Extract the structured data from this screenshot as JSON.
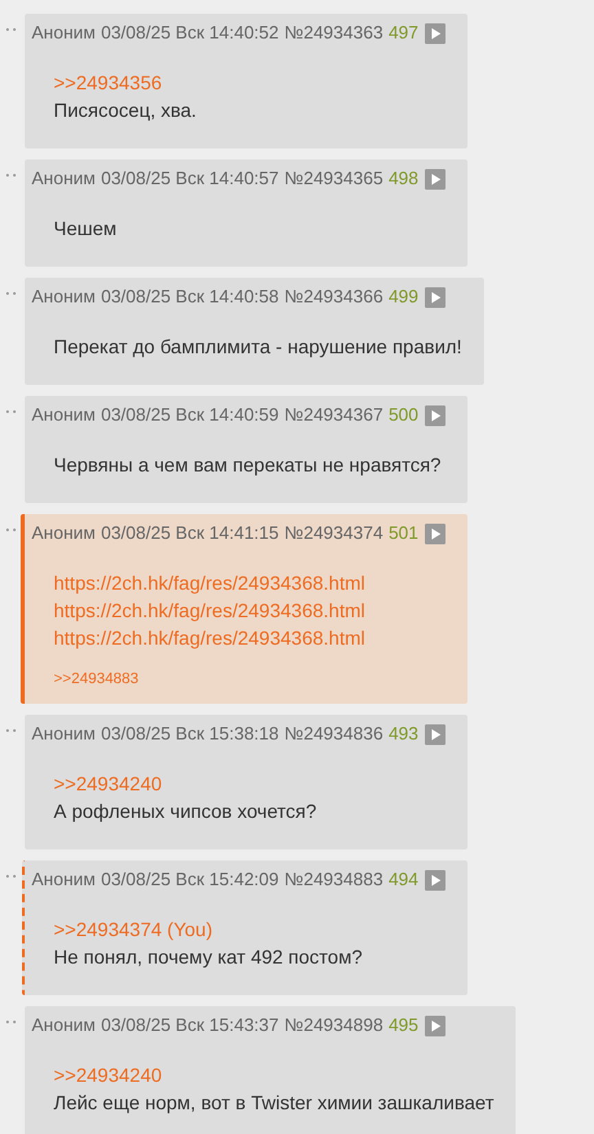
{
  "posts": [
    {
      "author": "Аноним",
      "datetime": "03/08/25 Вск 14:40:52",
      "number": "№24934363",
      "count": "497",
      "own": false,
      "replies_to_you": false,
      "lines": [
        {
          "kind": "reply",
          "text": ">>24934356"
        },
        {
          "kind": "text",
          "text": "Писясосец, хва."
        }
      ]
    },
    {
      "author": "Аноним",
      "datetime": "03/08/25 Вск 14:40:57",
      "number": "№24934365",
      "count": "498",
      "own": false,
      "replies_to_you": false,
      "lines": [
        {
          "kind": "text",
          "text": "Чешем"
        }
      ]
    },
    {
      "author": "Аноним",
      "datetime": "03/08/25 Вск 14:40:58",
      "number": "№24934366",
      "count": "499",
      "own": false,
      "replies_to_you": false,
      "lines": [
        {
          "kind": "text",
          "text": "Перекат до бамплимита - нарушение правил!"
        }
      ]
    },
    {
      "author": "Аноним",
      "datetime": "03/08/25 Вск 14:40:59",
      "number": "№24934367",
      "count": "500",
      "own": false,
      "replies_to_you": false,
      "lines": [
        {
          "kind": "text",
          "text": "Червяны а чем вам перекаты не нравятся?"
        }
      ]
    },
    {
      "author": "Аноним",
      "datetime": "03/08/25 Вск 14:41:15",
      "number": "№24934374",
      "count": "501",
      "own": true,
      "replies_to_you": false,
      "lines": [
        {
          "kind": "url",
          "text": "https://2ch.hk/fag/res/24934368.html"
        },
        {
          "kind": "url",
          "text": "https://2ch.hk/fag/res/24934368.html"
        },
        {
          "kind": "url",
          "text": "https://2ch.hk/fag/res/24934368.html"
        }
      ],
      "backlinks": [
        ">>24934883"
      ]
    },
    {
      "author": "Аноним",
      "datetime": "03/08/25 Вск 15:38:18",
      "number": "№24934836",
      "count": "493",
      "own": false,
      "replies_to_you": false,
      "lines": [
        {
          "kind": "reply",
          "text": ">>24934240"
        },
        {
          "kind": "text",
          "text": "А рофленых чипсов хочется?"
        }
      ]
    },
    {
      "author": "Аноним",
      "datetime": "03/08/25 Вск 15:42:09",
      "number": "№24934883",
      "count": "494",
      "own": false,
      "replies_to_you": true,
      "lines": [
        {
          "kind": "reply",
          "text": ">>24934374 (You)"
        },
        {
          "kind": "text",
          "text": "Не понял, почему кат 492 постом?"
        }
      ]
    },
    {
      "author": "Аноним",
      "datetime": "03/08/25 Вск 15:43:37",
      "number": "№24934898",
      "count": "495",
      "own": false,
      "replies_to_you": false,
      "lines": [
        {
          "kind": "reply",
          "text": ">>24934240"
        },
        {
          "kind": "text",
          "text": "Лейс еще норм, вот в Twister химии зашкаливает"
        }
      ]
    }
  ]
}
